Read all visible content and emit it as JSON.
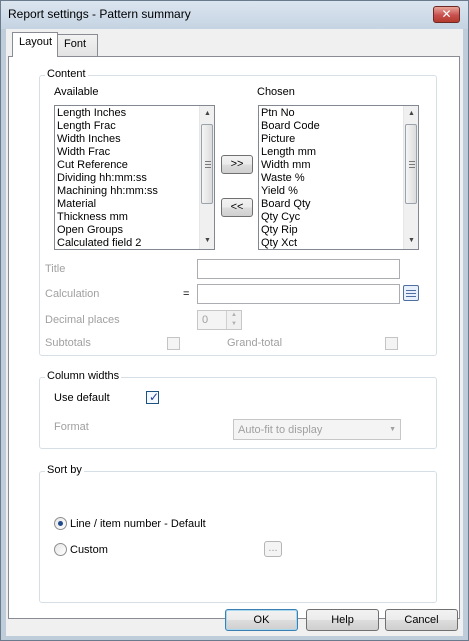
{
  "window": {
    "title": "Report settings - Pattern summary"
  },
  "tabs": [
    {
      "label": "Layout"
    },
    {
      "label": "Font"
    }
  ],
  "content": {
    "group_label": "Content",
    "available_label": "Available",
    "chosen_label": "Chosen",
    "available_items": [
      "Length Inches",
      "Length Frac",
      "Width Inches",
      "Width Frac",
      "Cut Reference",
      "Dividing hh:mm:ss",
      "Machining hh:mm:ss",
      "Material",
      "Thickness mm",
      "Open Groups",
      "Calculated field 2"
    ],
    "chosen_items": [
      "Ptn No",
      "Board Code",
      "Picture",
      "Length mm",
      "Width mm",
      "Waste %",
      "Yield %",
      "Board Qty",
      "Qty Cyc",
      "Qty Rip",
      "Qty Xct"
    ],
    "add_button": ">>",
    "remove_button": "<<",
    "title_label": "Title",
    "title_value": "",
    "calculation_label": "Calculation",
    "equals_sign": "=",
    "calculation_value": "",
    "decimal_label": "Decimal places",
    "decimal_value": "0",
    "subtotals_label": "Subtotals",
    "grandtotal_label": "Grand-total"
  },
  "column_widths": {
    "group_label": "Column widths",
    "use_default_label": "Use default",
    "use_default_checked": true,
    "format_label": "Format",
    "format_value": "Auto-fit to display"
  },
  "sort_by": {
    "group_label": "Sort by",
    "option1_label": "Line / item number - Default",
    "option2_label": "Custom",
    "selected": "option1",
    "browse_label": "..."
  },
  "buttons": {
    "ok": "OK",
    "help": "Help",
    "cancel": "Cancel"
  },
  "colors": {
    "checkmark": "#21409a",
    "radio_dot": "#1f4a8c",
    "disabled_text": "#a0a0a0"
  }
}
